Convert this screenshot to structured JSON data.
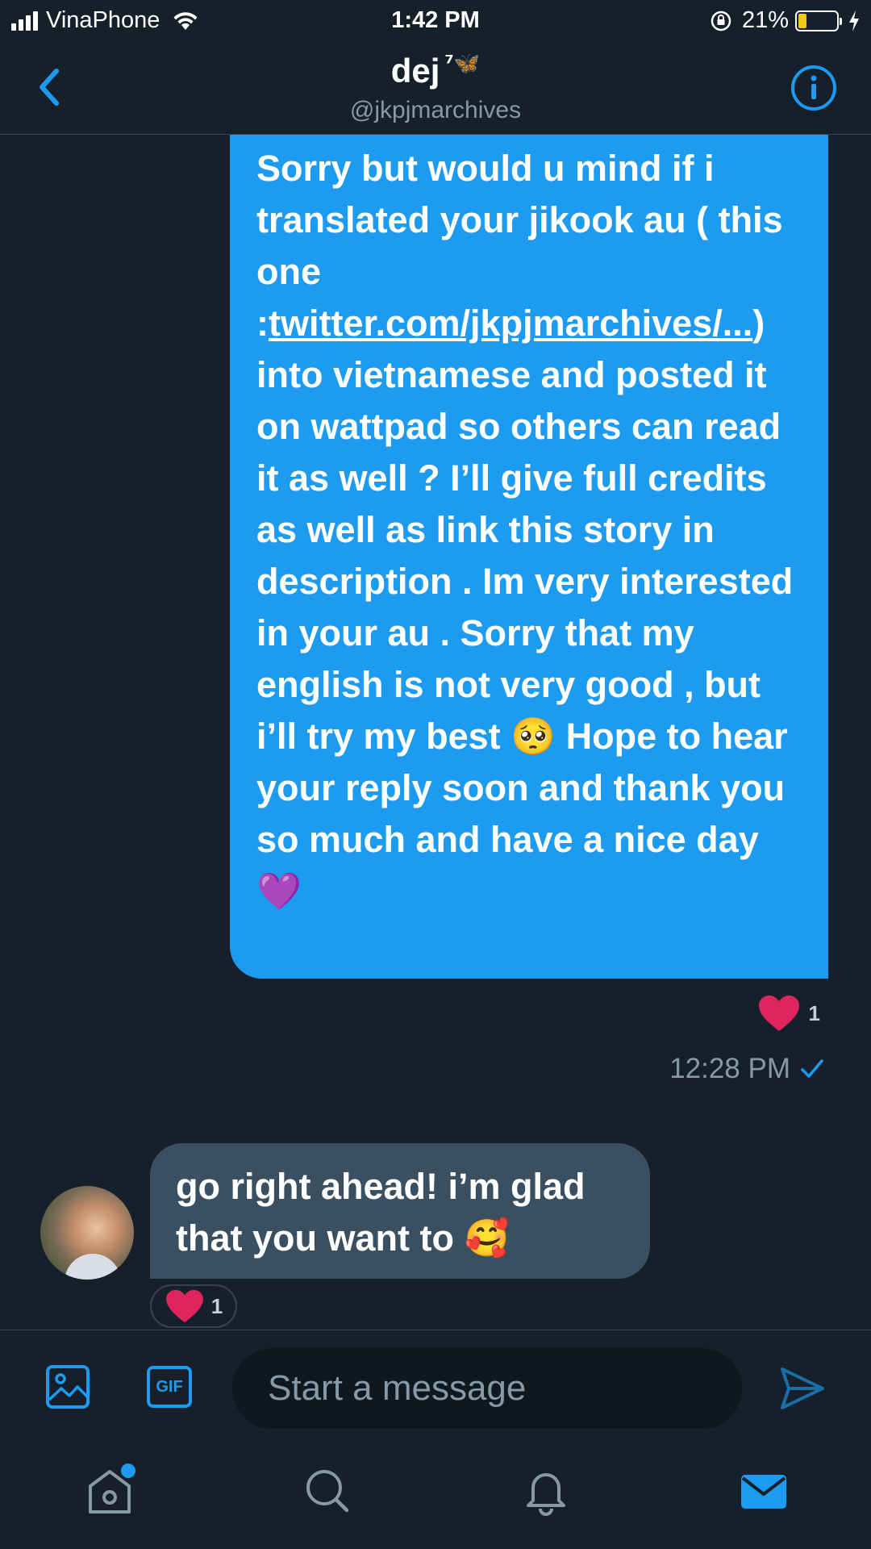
{
  "status_bar": {
    "carrier": "VinaPhone",
    "time": "1:42 PM",
    "battery_percent": "21%",
    "battery_level": 0.21
  },
  "header": {
    "name": "dej",
    "badge": "⁷🦋",
    "handle": "@jkpjmarchives",
    "back_icon": "chevron-left-icon",
    "info_icon": "info-icon"
  },
  "messages": {
    "sent": {
      "text_before_link": "Sorry but would u mind if i translated your jikook au ( this one :",
      "link": "twitter.com/jkpjmarchives/...",
      "text_after_link": ") into vietnamese and posted it on wattpad so others can read it as well ? I’ll give full credits as well as link this story in description . Im very interested in your au . Sorry that my english is not very good , but i’ll try my best ",
      "emoji_1": "🥺",
      "text_after_emoji_1": " Hope to hear your reply soon and thank you so much and have a nice day ",
      "emoji_2": "💜",
      "reaction_count": "1",
      "timestamp": "12:28 PM",
      "status_icon": "checkmark-icon"
    },
    "received": {
      "text": "go right ahead! i’m glad that you want to ",
      "emoji": "🥰",
      "reaction_count": "1"
    }
  },
  "composer": {
    "placeholder": "Start a message",
    "gif_label": "GIF"
  },
  "tab_bar": {
    "tabs": [
      "home-icon",
      "search-icon",
      "notifications-icon",
      "messages-icon"
    ]
  },
  "colors": {
    "background": "#15202b",
    "accent": "#1d9bf0",
    "received_bubble": "#3a4f60",
    "heart": "#e0245e"
  }
}
